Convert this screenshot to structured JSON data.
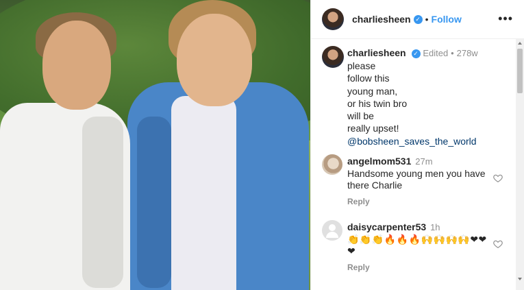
{
  "post": {
    "username": "charliesheen",
    "separator": "•",
    "follow_label": "Follow",
    "more_label": "•••"
  },
  "caption": {
    "username": "charliesheen",
    "edited": "Edited",
    "separator": "•",
    "time": "278w",
    "lines": [
      "please",
      "follow this",
      "young man,",
      "or his twin bro",
      "will be",
      "really upset!"
    ],
    "mention": "@bobsheen_saves_the_world"
  },
  "comments": [
    {
      "username": "angelmom531",
      "time": "27m",
      "text": "Handsome young men you have there Charlie",
      "reply_label": "Reply"
    },
    {
      "username": "daisycarpenter53",
      "time": "1h",
      "text": "👏👏👏🔥🔥🔥🙌🙌🙌🙌❤❤❤",
      "reply_label": "Reply"
    }
  ],
  "icons": {
    "verified": "verified-badge-icon",
    "more": "more-options-icon",
    "like": "heart-outline-icon"
  },
  "colors": {
    "accent": "#3897f0",
    "mention": "#00376b",
    "muted": "#8e8e8e"
  }
}
